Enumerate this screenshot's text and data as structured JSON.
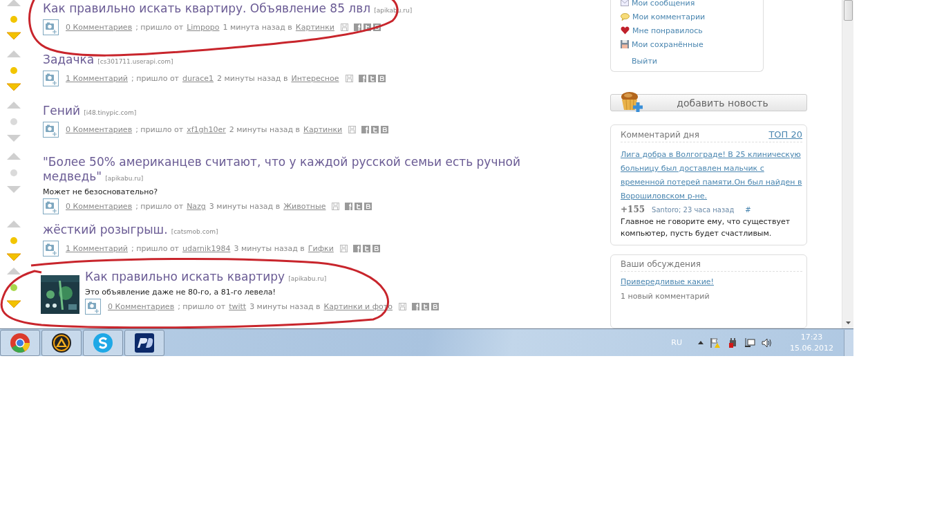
{
  "posts": [
    {
      "kind": "text",
      "title": "Как правильно искать квартиру. Объявление 85 лвл",
      "source": "[apikabu.ru]",
      "comments": "0 Комментариев",
      "from_label": "; пришло от",
      "author": "Limpopo",
      "time": "1 минута назад в",
      "category": "Картинки",
      "color": "#f2c500",
      "down_active": true
    },
    {
      "kind": "text",
      "title": "Задачка",
      "source": "[cs301711.userapi.com]",
      "comments": "1 Комментарий",
      "from_label": "; пришло от",
      "author": "durace1",
      "time": "2 минуты назад в",
      "category": "Интересное",
      "color": "#f2c500",
      "down_active": true
    },
    {
      "kind": "text",
      "title": "Гений",
      "source": "[i48.tinypic.com]",
      "comments": "0 Комментариев",
      "from_label": "; пришло от",
      "author": "xf1gh10er",
      "time": "2 минуты назад в",
      "category": "Картинки",
      "color": "#dadada",
      "down_active": false
    },
    {
      "kind": "text",
      "title": "\"Более 50% американцев считают, что у каждой русской семьи есть ручной медведь\"",
      "source": "[apikabu.ru]",
      "description": "Может не безосновательно?",
      "comments": "0 Комментариев",
      "from_label": "; пришло от",
      "author": "Nazg",
      "time": "3 минуты назад в",
      "category": "Животные",
      "color": "#dadada",
      "down_active": false
    },
    {
      "kind": "text",
      "title": "жёсткий розыгрыш.",
      "source": "[catsmob.com]",
      "comments": "1 Комментарий",
      "from_label": "; пришло от",
      "author": "udarnik1984",
      "time": "3 минуты назад в",
      "category": "Гифки",
      "color": "#f2c500",
      "down_active": true
    },
    {
      "kind": "picture",
      "title": "Как правильно искать квартиру",
      "source": "[apikabu.ru]",
      "description": "Это объявление даже не 80-го, а 81-го левела!",
      "comments": "0 Комментариев",
      "from_label": "; пришло от",
      "author": "twitt",
      "time": "3 минуты назад в",
      "category": "Картинки и фото",
      "color": "#a8d84c",
      "down_active": true
    }
  ],
  "user_menu": {
    "items": [
      {
        "kind": "envelope",
        "label": "Мои сообщения"
      },
      {
        "kind": "bubble",
        "label": "Мои комментарии"
      },
      {
        "kind": "heart",
        "label": "Мне понравилось"
      },
      {
        "kind": "floppy",
        "label": "Мои сохранённые"
      }
    ],
    "logout": "Выйти"
  },
  "add_news": "добавить новость",
  "comment_of_day": {
    "title": "Комментарий дня",
    "top_link": "ТОП 20",
    "post_link": "Лига добра в Волгограде! В 25 клиническую больницу был доставлен мальчик с временной потерей памяти.Он был найден в Ворошиловском р-не.",
    "score": "+155",
    "byline": "Santoro; 23 часа назад",
    "anchor": "#",
    "text": "Главное не говорите ему, что существует компьютер, пусть будет счастливым."
  },
  "discussions": {
    "title": "Ваши обсуждения",
    "link": "Привередливые какие!",
    "note": "1 новый комментарий"
  },
  "taskbar": {
    "apps": [
      {
        "kind": "chrome",
        "selected": false
      },
      {
        "kind": "aimp",
        "selected": false
      },
      {
        "kind": "skype",
        "selected": false
      },
      {
        "kind": "pd",
        "selected": false
      }
    ],
    "language": "RU",
    "time": "17:23",
    "date": "15.06.2012"
  }
}
